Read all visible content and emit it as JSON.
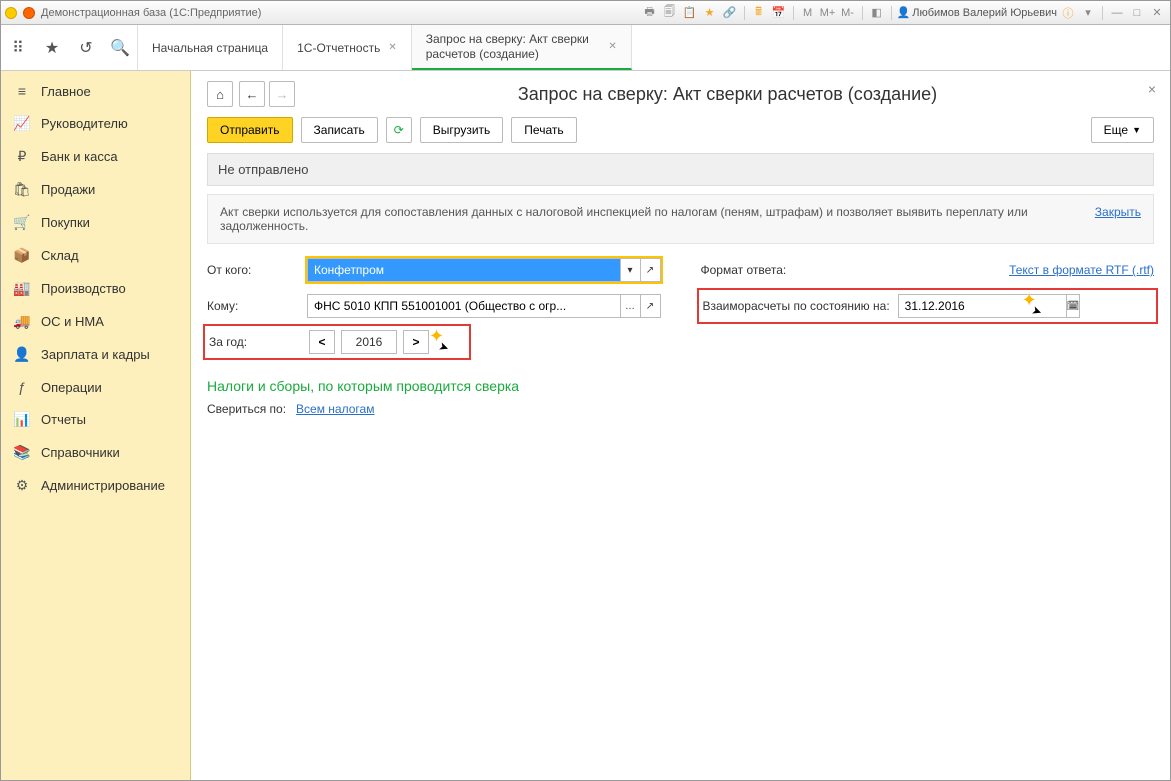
{
  "titlebar": {
    "app_name": "Демонстрационная база  (1С:Предприятие)",
    "m_labels": [
      "M",
      "M+",
      "M-"
    ],
    "user": "Любимов Валерий Юрьевич"
  },
  "tabs": [
    {
      "label": "Начальная страница",
      "closable": false
    },
    {
      "label": "1С-Отчетность",
      "closable": true
    },
    {
      "label": "Запрос на сверку: Акт сверки расчетов (создание)",
      "closable": true,
      "active": true
    }
  ],
  "sidebar": [
    {
      "icon": "≡",
      "label": "Главное"
    },
    {
      "icon": "📈",
      "label": "Руководителю"
    },
    {
      "icon": "₽",
      "label": "Банк и касса"
    },
    {
      "icon": "🛍",
      "label": "Продажи"
    },
    {
      "icon": "🛒",
      "label": "Покупки"
    },
    {
      "icon": "📦",
      "label": "Склад"
    },
    {
      "icon": "🏭",
      "label": "Производство"
    },
    {
      "icon": "🚚",
      "label": "ОС и НМА"
    },
    {
      "icon": "👤",
      "label": "Зарплата и кадры"
    },
    {
      "icon": "ƒ",
      "label": "Операции"
    },
    {
      "icon": "📊",
      "label": "Отчеты"
    },
    {
      "icon": "📚",
      "label": "Справочники"
    },
    {
      "icon": "⚙",
      "label": "Администрирование"
    }
  ],
  "page": {
    "title": "Запрос на сверку: Акт сверки расчетов (создание)",
    "actions": {
      "send": "Отправить",
      "save": "Записать",
      "export": "Выгрузить",
      "print": "Печать",
      "more": "Еще"
    },
    "status": "Не отправлено",
    "info_text": "Акт сверки используется для сопоставления данных с налоговой инспекцией по налогам (пеням, штрафам) и позволяет выявить переплату или задолженность.",
    "info_close": "Закрыть",
    "from_label": "От кого:",
    "from_value": "Конфетпром",
    "to_label": "Кому:",
    "to_value": "ФНС 5010 КПП 551001001 (Общество с огр...",
    "year_label": "За год:",
    "year_value": "2016",
    "format_label": "Формат ответа:",
    "format_link": "Текст в формате RTF (.rtf)",
    "asof_label": "Взаиморасчеты по состоянию на:",
    "asof_value": "31.12.2016",
    "section": "Налоги и сборы, по которым проводится сверка",
    "verify_label": "Свериться по:",
    "verify_link": "Всем налогам"
  }
}
